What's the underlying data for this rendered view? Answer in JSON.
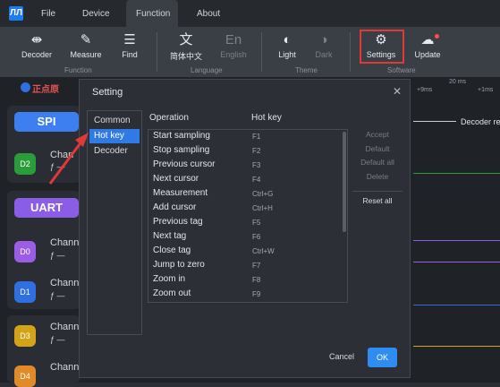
{
  "menubar": {
    "logo": "ЛЛ",
    "items": [
      "File",
      "Device",
      "Function",
      "About"
    ]
  },
  "ribbon": {
    "buttons": [
      {
        "label": "Decoder",
        "icon": "decoder-icon",
        "glyph": "⇼"
      },
      {
        "label": "Measure",
        "icon": "ruler-icon",
        "glyph": "✎"
      },
      {
        "label": "Find",
        "icon": "find-icon",
        "glyph": "☰"
      },
      {
        "label": "简体中文",
        "icon": "chinese-language-icon",
        "glyph": "文"
      },
      {
        "label": "English",
        "icon": "english-language-icon",
        "glyph": "En"
      },
      {
        "label": "Light",
        "icon": "light-theme-icon",
        "glyph": "◐"
      },
      {
        "label": "Dark",
        "icon": "dark-theme-icon",
        "glyph": "◑"
      },
      {
        "label": "Settings",
        "icon": "gear-icon",
        "glyph": "⚙"
      },
      {
        "label": "Update",
        "icon": "cloud-upload-icon",
        "glyph": "☁"
      }
    ],
    "groups": [
      "Function",
      "Language",
      "Theme",
      "Software"
    ]
  },
  "workspace": {
    "brand": "正点原",
    "ruler": {
      "t1": "+9ms",
      "t2": "20 ms",
      "t3": "+1ms"
    },
    "decoder_label": "Decoder re",
    "protocols": [
      {
        "label": "SPI"
      },
      {
        "label": "UART"
      }
    ],
    "channels": [
      {
        "id": "D2",
        "label": "Chan"
      },
      {
        "id": "D0",
        "label": "Chann"
      },
      {
        "id": "D1",
        "label": "Chann"
      },
      {
        "id": "D3",
        "label": "Chann"
      },
      {
        "id": "D4",
        "label": "Chann"
      }
    ],
    "edge_glyph": "ƒ —"
  },
  "dialog": {
    "title": "Setting",
    "close": "✕",
    "nav": [
      "Common",
      "Hot key",
      "Decoder"
    ],
    "selected_nav": "Hot key",
    "columns": {
      "operation": "Operation",
      "hotkey": "Hot key"
    },
    "rows": [
      {
        "op": "Start sampling",
        "key": "F1"
      },
      {
        "op": "Stop sampling",
        "key": "F2"
      },
      {
        "op": "Previous cursor",
        "key": "F3"
      },
      {
        "op": "Next cursor",
        "key": "F4"
      },
      {
        "op": "Measurement",
        "key": "Ctrl+G"
      },
      {
        "op": "Add cursor",
        "key": "Ctrl+H"
      },
      {
        "op": "Previous tag",
        "key": "F5"
      },
      {
        "op": "Next tag",
        "key": "F6"
      },
      {
        "op": "Close tag",
        "key": "Ctrl+W"
      },
      {
        "op": "Jump to zero",
        "key": "F7"
      },
      {
        "op": "Zoom in",
        "key": "F8"
      },
      {
        "op": "Zoom out",
        "key": "F9"
      }
    ],
    "side_buttons": [
      "Accept",
      "Default",
      "Default all",
      "Delete",
      "Reset all"
    ],
    "cancel": "Cancel",
    "ok": "OK"
  },
  "colors": {
    "accent": "#2f7ae5",
    "highlight_box": "#e0393a",
    "arrow": "#e0393a",
    "spi": "#3d7ff0",
    "uart": "#8b5ce6",
    "d2": "#2a9d3a",
    "d0": "#9b5de5",
    "d1": "#2f6fe0",
    "d3": "#d4a418",
    "d4": "#e08a2a"
  }
}
